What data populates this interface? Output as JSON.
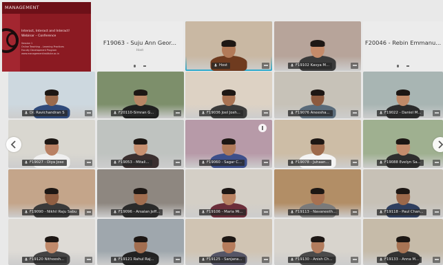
{
  "shared_screen": {
    "header": "MANAGEMENT",
    "title_line1": "Interact, Interact and Interact!",
    "title_line2": "Webinar – Conference",
    "lines": [
      "Session 1",
      "Online Teaching – Learning Practices",
      "Faculty Development Program",
      "www.managementinstitute.ac.in"
    ]
  },
  "placeholder_tiles": [
    {
      "name": "F19063 - Suju Ann Geor...",
      "sub": "Host"
    },
    {
      "name": "F20046 - Rebin Emmanu...",
      "sub": ""
    }
  ],
  "participants": [
    {
      "label": "Host",
      "active": true
    },
    {
      "label": "F19102 Kavya M..."
    },
    {
      "label": "Dr. Ravichandran S"
    },
    {
      "label": "F20110-Simran G..."
    },
    {
      "label": "F19036 Joel Josh..."
    },
    {
      "label": "F19076 Aneesha..."
    },
    {
      "label": "F19022 - Daniel M..."
    },
    {
      "label": "F19027 - Diya Jose"
    },
    {
      "label": "F19053 - Mitali..."
    },
    {
      "label": "F19060 - Sagar C..."
    },
    {
      "label": "F19078 - Juhaan..."
    },
    {
      "label": "F19088 Evelyn Sa..."
    },
    {
      "label": "F19090 - Nikhil Raju Sabu"
    },
    {
      "label": "F19096 - Arsalan Jeff..."
    },
    {
      "label": "F19106 - Maria Mi..."
    },
    {
      "label": "F19113 - Navaneeth..."
    },
    {
      "label": "F19118 - Paul Chan..."
    },
    {
      "label": "F19120 Nitheesh..."
    },
    {
      "label": "F19121 Rahul Raj..."
    },
    {
      "label": "F19125 - Sanjana..."
    },
    {
      "label": "F19130 - Anish Ch..."
    },
    {
      "label": "F19133 - Anna M..."
    }
  ],
  "colors": {
    "active_border": "#2ec0e8",
    "share_bg": "#8b1a22",
    "mic_icon": "#cfcfcf"
  },
  "icons": [
    "mic-icon",
    "more-icon",
    "chevron-left-icon",
    "chevron-right-icon"
  ]
}
